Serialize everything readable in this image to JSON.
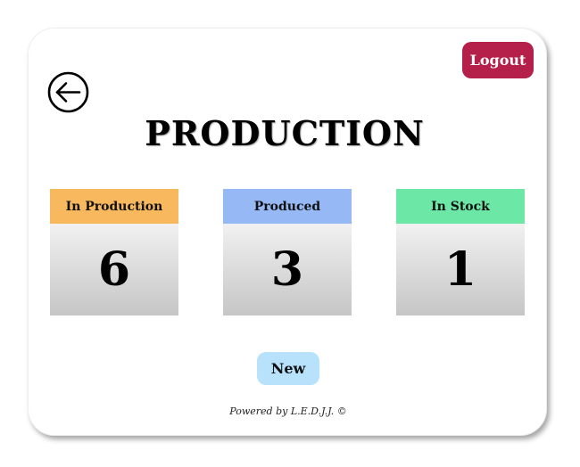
{
  "header": {
    "logout_label": "Logout",
    "back_icon": "arrow-left-circle-icon"
  },
  "page": {
    "title": "PRODUCTION"
  },
  "stats": [
    {
      "label": "In Production",
      "value": "6",
      "color": "#f8b85e"
    },
    {
      "label": "Produced",
      "value": "3",
      "color": "#96b9f5"
    },
    {
      "label": "In Stock",
      "value": "1",
      "color": "#6ce7a5"
    }
  ],
  "actions": {
    "new_label": "New"
  },
  "footer": {
    "text": "Powered by L.E.D.J.J. ©"
  }
}
